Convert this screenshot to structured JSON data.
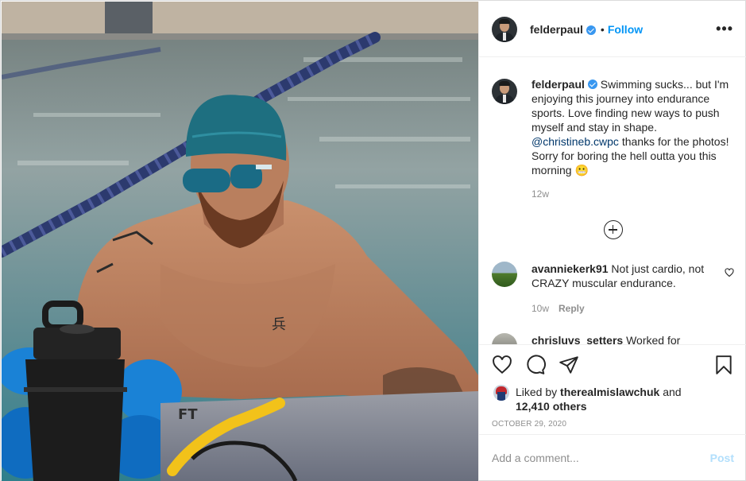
{
  "post": {
    "username": "felderpaul",
    "follow_label": "Follow",
    "dot": "•",
    "more_label": "•••",
    "caption_text": "Swimming sucks... but I'm enjoying this journey into endurance sports. Love finding new ways to push myself and stay in shape.",
    "caption_mention": "@christineb.cwpc",
    "caption_text2": "thanks for the photos! Sorry for boring the hell outta you this morning",
    "caption_emoji": "😬",
    "caption_time": "12w",
    "photo_text": "FT"
  },
  "comments": [
    {
      "username": "avanniekerk91",
      "text": "Not just cardio, not CRAZY muscular endurance.",
      "time": "10w",
      "reply_label": "Reply"
    },
    {
      "username": "chrisluvs_setters",
      "text": "Worked for"
    }
  ],
  "likes": {
    "prefix": "Liked by",
    "user": "therealmislawchuk",
    "and": "and",
    "others": "12,410 others"
  },
  "date": "OCTOBER 29, 2020",
  "add_comment": {
    "placeholder": "Add a comment...",
    "post_label": "Post"
  },
  "icons": {
    "like": "heart-icon",
    "comment": "comment-icon",
    "share": "paper-plane-icon",
    "save": "bookmark-icon",
    "load_more": "plus-circle-icon"
  },
  "colors": {
    "accent": "#0095f6",
    "verified": "#3897f0",
    "muted": "#8e8e8e",
    "post_disabled": "#b2dffc"
  }
}
